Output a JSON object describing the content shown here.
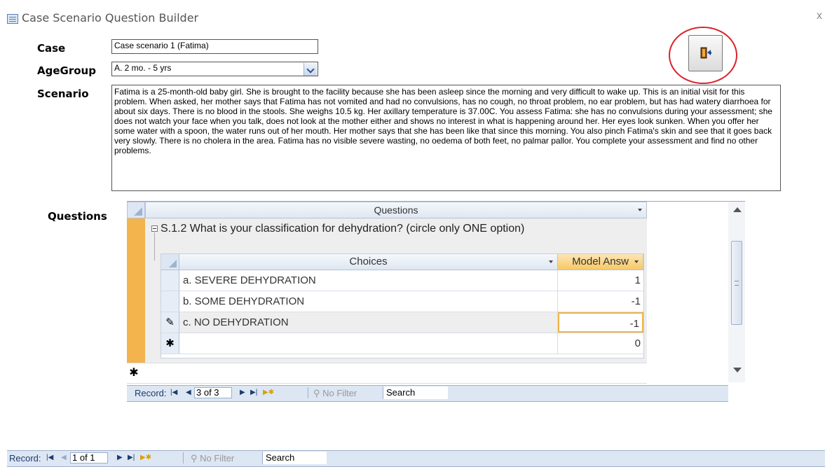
{
  "window": {
    "title": "Case Scenario Question Builder",
    "close_label": "x"
  },
  "form": {
    "case_label": "Case",
    "case_value": "Case scenario 1 (Fatima)",
    "agegroup_label": "AgeGroup",
    "agegroup_value": "A. 2 mo. - 5 yrs",
    "scenario_label": "Scenario",
    "scenario_value": "Fatima is a 25-month-old baby girl. She is brought to the facility because she has been asleep since the morning and very difficult to wake up. This is an initial visit for this problem. When asked, her mother says that Fatima has not vomited and had no convulsions, has no cough, no throat problem, no ear problem, but has had watery diarrhoea for about six days. There is no blood in the stools. She weighs 10.5 kg. Her axillary temperature is 37.00C. You assess Fatima: she has no convulsions during your assessment; she does not watch your face when you talk, does not look at the mother either and shows no interest in what is happening around her. Her eyes look sunken. When you offer her some water with a spoon, the water runs out of her mouth. Her mother says that she has been like that since this morning. You also pinch Fatima's skin and see that it goes back very slowly. There is no cholera in the area. Fatima has no visible severe wasting, no oedema of both feet, no palmar pallor. You complete your assessment and find no other problems.",
    "questions_label": "Questions",
    "exit_icon": "exit-door-icon"
  },
  "subform": {
    "column_header": "Questions",
    "question_text": "S.1.2 What is your classification for dehydration? (circle only ONE option)",
    "choices_header": "Choices",
    "model_answer_header": "Model Answ",
    "rows": [
      {
        "choice": "a. SEVERE DEHYDRATION",
        "answer": "1"
      },
      {
        "choice": "b. SOME DEHYDRATION",
        "answer": "-1"
      },
      {
        "choice": "c. NO DEHYDRATION",
        "answer": "-1"
      }
    ],
    "new_row_answer": "0",
    "new_row_marker": "✱",
    "edit_marker": "✎"
  },
  "subform_nav": {
    "label": "Record:",
    "record": "3 of 3",
    "filter": "No Filter",
    "search": "Search"
  },
  "main_nav": {
    "label": "Record:",
    "record": "1 of 1",
    "filter": "No Filter",
    "search": "Search"
  },
  "colors": {
    "accent": "#f3b34d",
    "highlight_circle": "#d8242a",
    "nav_bg": "#dde6f3"
  }
}
